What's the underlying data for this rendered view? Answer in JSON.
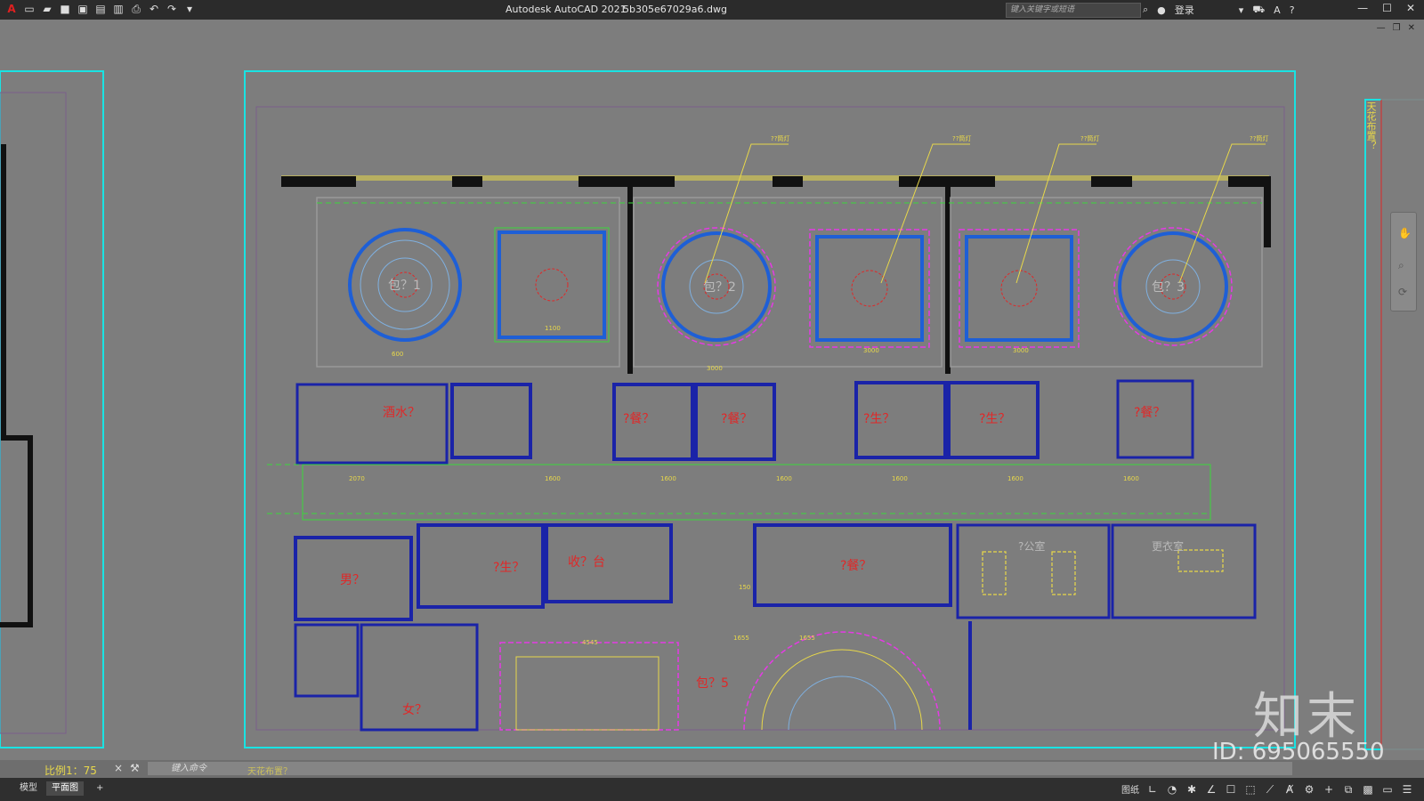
{
  "titlebar": {
    "logo": "A",
    "app_name": "Autodesk AutoCAD 2021",
    "file_name": "5b305e67029a6.dwg",
    "search_placeholder": "键入关键字或短语",
    "login_label": "登录",
    "quick_access_icons": [
      "new-icon",
      "open-icon",
      "save-icon",
      "saveas-icon",
      "plot-preview-icon",
      "publish-icon",
      "print-icon",
      "undo-icon",
      "redo-icon",
      "customize-icon"
    ]
  },
  "canvas": {
    "rooms": {
      "wine": "酒水？",
      "pkg1": "包？1",
      "pkg2": "包？2",
      "pkg3": "包？3",
      "pkg5": "包？5",
      "meal1": "?餐？",
      "meal2": "?餐？",
      "meal3": "?餐？",
      "meal4": "?餐？",
      "stu1": "?生？",
      "stu2": "?生？",
      "stu3": "?生？",
      "male": "男？",
      "female": "女？",
      "cashier": "收？台",
      "office": "?公室",
      "locker": "更衣室"
    },
    "dims": [
      "1600",
      "1600",
      "1600",
      "1600",
      "1600",
      "1600",
      "2070",
      "600",
      "3000",
      "3000",
      "1100",
      "3000",
      "150",
      "1655",
      "1655",
      "4545"
    ],
    "leader_labels": [
      "??筒灯",
      "??筒灯",
      "??筒灯",
      "??筒灯"
    ],
    "vertical_tag": "天花布置？",
    "colors": {
      "background": "#7d7d7d",
      "frame": "#19e3e3",
      "wall": "#111111",
      "wall_blue": "#1a23a8",
      "ceiling_blue": "#1e5fd6",
      "dim_yellow": "#e8d84a",
      "text_red": "#e02828",
      "grid_green": "#3ad63a",
      "magenta": "#e53ae5"
    }
  },
  "cmdline": {
    "scale_label": "比例1：75",
    "close_icon": "×",
    "placeholder": "键入命令",
    "hint": "天花布置？"
  },
  "statusbar": {
    "tab_model": "模型",
    "tab_plan": "平面图",
    "tab_add": "+",
    "paper_label": "图纸",
    "icons": [
      "snap-icon",
      "polar-icon",
      "osnap-icon",
      "otrack-icon",
      "lineweight-icon",
      "transparency-icon",
      "selection-icon",
      "annotation-icon",
      "workspace-icon",
      "units-icon",
      "isolate-icon",
      "hardware-icon",
      "clean-screen-icon",
      "customize-icon"
    ]
  },
  "watermark": {
    "logo": "知末",
    "id": "ID: 695065550"
  }
}
